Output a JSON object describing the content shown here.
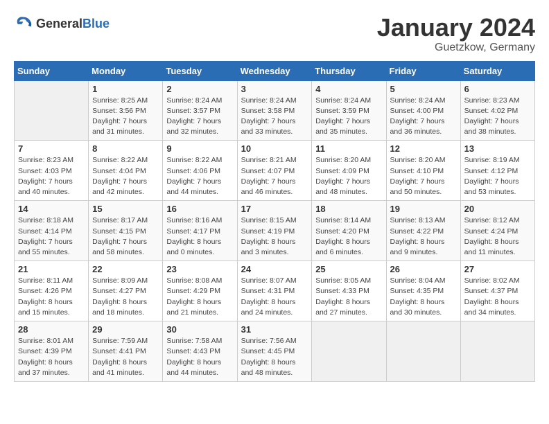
{
  "logo": {
    "general": "General",
    "blue": "Blue"
  },
  "title": "January 2024",
  "location": "Guetzkow, Germany",
  "days_of_week": [
    "Sunday",
    "Monday",
    "Tuesday",
    "Wednesday",
    "Thursday",
    "Friday",
    "Saturday"
  ],
  "weeks": [
    [
      {
        "day": "",
        "sunrise": "",
        "sunset": "",
        "daylight": ""
      },
      {
        "day": "1",
        "sunrise": "Sunrise: 8:25 AM",
        "sunset": "Sunset: 3:56 PM",
        "daylight": "Daylight: 7 hours and 31 minutes."
      },
      {
        "day": "2",
        "sunrise": "Sunrise: 8:24 AM",
        "sunset": "Sunset: 3:57 PM",
        "daylight": "Daylight: 7 hours and 32 minutes."
      },
      {
        "day": "3",
        "sunrise": "Sunrise: 8:24 AM",
        "sunset": "Sunset: 3:58 PM",
        "daylight": "Daylight: 7 hours and 33 minutes."
      },
      {
        "day": "4",
        "sunrise": "Sunrise: 8:24 AM",
        "sunset": "Sunset: 3:59 PM",
        "daylight": "Daylight: 7 hours and 35 minutes."
      },
      {
        "day": "5",
        "sunrise": "Sunrise: 8:24 AM",
        "sunset": "Sunset: 4:00 PM",
        "daylight": "Daylight: 7 hours and 36 minutes."
      },
      {
        "day": "6",
        "sunrise": "Sunrise: 8:23 AM",
        "sunset": "Sunset: 4:02 PM",
        "daylight": "Daylight: 7 hours and 38 minutes."
      }
    ],
    [
      {
        "day": "7",
        "sunrise": "Sunrise: 8:23 AM",
        "sunset": "Sunset: 4:03 PM",
        "daylight": "Daylight: 7 hours and 40 minutes."
      },
      {
        "day": "8",
        "sunrise": "Sunrise: 8:22 AM",
        "sunset": "Sunset: 4:04 PM",
        "daylight": "Daylight: 7 hours and 42 minutes."
      },
      {
        "day": "9",
        "sunrise": "Sunrise: 8:22 AM",
        "sunset": "Sunset: 4:06 PM",
        "daylight": "Daylight: 7 hours and 44 minutes."
      },
      {
        "day": "10",
        "sunrise": "Sunrise: 8:21 AM",
        "sunset": "Sunset: 4:07 PM",
        "daylight": "Daylight: 7 hours and 46 minutes."
      },
      {
        "day": "11",
        "sunrise": "Sunrise: 8:20 AM",
        "sunset": "Sunset: 4:09 PM",
        "daylight": "Daylight: 7 hours and 48 minutes."
      },
      {
        "day": "12",
        "sunrise": "Sunrise: 8:20 AM",
        "sunset": "Sunset: 4:10 PM",
        "daylight": "Daylight: 7 hours and 50 minutes."
      },
      {
        "day": "13",
        "sunrise": "Sunrise: 8:19 AM",
        "sunset": "Sunset: 4:12 PM",
        "daylight": "Daylight: 7 hours and 53 minutes."
      }
    ],
    [
      {
        "day": "14",
        "sunrise": "Sunrise: 8:18 AM",
        "sunset": "Sunset: 4:14 PM",
        "daylight": "Daylight: 7 hours and 55 minutes."
      },
      {
        "day": "15",
        "sunrise": "Sunrise: 8:17 AM",
        "sunset": "Sunset: 4:15 PM",
        "daylight": "Daylight: 7 hours and 58 minutes."
      },
      {
        "day": "16",
        "sunrise": "Sunrise: 8:16 AM",
        "sunset": "Sunset: 4:17 PM",
        "daylight": "Daylight: 8 hours and 0 minutes."
      },
      {
        "day": "17",
        "sunrise": "Sunrise: 8:15 AM",
        "sunset": "Sunset: 4:19 PM",
        "daylight": "Daylight: 8 hours and 3 minutes."
      },
      {
        "day": "18",
        "sunrise": "Sunrise: 8:14 AM",
        "sunset": "Sunset: 4:20 PM",
        "daylight": "Daylight: 8 hours and 6 minutes."
      },
      {
        "day": "19",
        "sunrise": "Sunrise: 8:13 AM",
        "sunset": "Sunset: 4:22 PM",
        "daylight": "Daylight: 8 hours and 9 minutes."
      },
      {
        "day": "20",
        "sunrise": "Sunrise: 8:12 AM",
        "sunset": "Sunset: 4:24 PM",
        "daylight": "Daylight: 8 hours and 11 minutes."
      }
    ],
    [
      {
        "day": "21",
        "sunrise": "Sunrise: 8:11 AM",
        "sunset": "Sunset: 4:26 PM",
        "daylight": "Daylight: 8 hours and 15 minutes."
      },
      {
        "day": "22",
        "sunrise": "Sunrise: 8:09 AM",
        "sunset": "Sunset: 4:27 PM",
        "daylight": "Daylight: 8 hours and 18 minutes."
      },
      {
        "day": "23",
        "sunrise": "Sunrise: 8:08 AM",
        "sunset": "Sunset: 4:29 PM",
        "daylight": "Daylight: 8 hours and 21 minutes."
      },
      {
        "day": "24",
        "sunrise": "Sunrise: 8:07 AM",
        "sunset": "Sunset: 4:31 PM",
        "daylight": "Daylight: 8 hours and 24 minutes."
      },
      {
        "day": "25",
        "sunrise": "Sunrise: 8:05 AM",
        "sunset": "Sunset: 4:33 PM",
        "daylight": "Daylight: 8 hours and 27 minutes."
      },
      {
        "day": "26",
        "sunrise": "Sunrise: 8:04 AM",
        "sunset": "Sunset: 4:35 PM",
        "daylight": "Daylight: 8 hours and 30 minutes."
      },
      {
        "day": "27",
        "sunrise": "Sunrise: 8:02 AM",
        "sunset": "Sunset: 4:37 PM",
        "daylight": "Daylight: 8 hours and 34 minutes."
      }
    ],
    [
      {
        "day": "28",
        "sunrise": "Sunrise: 8:01 AM",
        "sunset": "Sunset: 4:39 PM",
        "daylight": "Daylight: 8 hours and 37 minutes."
      },
      {
        "day": "29",
        "sunrise": "Sunrise: 7:59 AM",
        "sunset": "Sunset: 4:41 PM",
        "daylight": "Daylight: 8 hours and 41 minutes."
      },
      {
        "day": "30",
        "sunrise": "Sunrise: 7:58 AM",
        "sunset": "Sunset: 4:43 PM",
        "daylight": "Daylight: 8 hours and 44 minutes."
      },
      {
        "day": "31",
        "sunrise": "Sunrise: 7:56 AM",
        "sunset": "Sunset: 4:45 PM",
        "daylight": "Daylight: 8 hours and 48 minutes."
      },
      {
        "day": "",
        "sunrise": "",
        "sunset": "",
        "daylight": ""
      },
      {
        "day": "",
        "sunrise": "",
        "sunset": "",
        "daylight": ""
      },
      {
        "day": "",
        "sunrise": "",
        "sunset": "",
        "daylight": ""
      }
    ]
  ]
}
